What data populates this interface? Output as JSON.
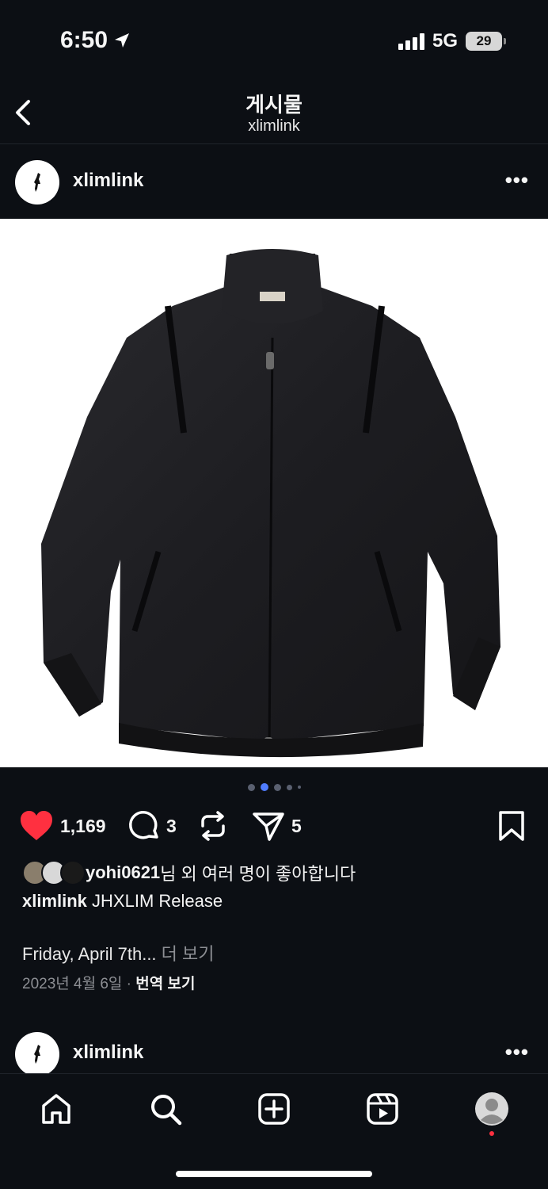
{
  "status": {
    "time": "6:50",
    "network": "5G",
    "battery": "29"
  },
  "header": {
    "title": "게시물",
    "subtitle": "xlimlink"
  },
  "post": {
    "username": "xlimlink",
    "more_icon": "more-horizontal-icon",
    "carousel_count": 5,
    "carousel_active": 1,
    "likes": "1,169",
    "comments": "3",
    "shares": "5",
    "liked_by_user": "yohi0621",
    "liked_by_suffix": "님 외 여러 명이 좋아합니다",
    "caption_user": "xlimlink",
    "caption_text": " JHXLIM Release",
    "caption_more_text": "Friday, April 7th...",
    "caption_more_link": " 더 보기",
    "date": "2023년 4월 6일",
    "date_sep": " · ",
    "translate": "번역 보기",
    "colors": {
      "like": "#ff3040",
      "accent": "#4f7cff"
    }
  },
  "next_post": {
    "username": "xlimlink"
  },
  "tabbar": {
    "items": [
      "home-icon",
      "search-icon",
      "create-icon",
      "reels-icon",
      "profile-icon"
    ]
  }
}
